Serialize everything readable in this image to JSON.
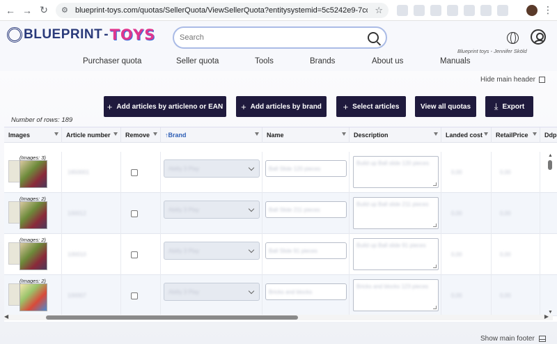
{
  "browser": {
    "url": "blueprint-toys.com/quotas/SellerQuota/ViewSellerQuota?entitysystemid=5c5242e9-7cdb-4d49-8..."
  },
  "header": {
    "logo_left": "BLUEPRINT",
    "logo_dash": "-",
    "logo_right": "TOYS",
    "search_placeholder": "Search",
    "user_text": "Blueprint toys - Jennifer Sköld",
    "nav": [
      "Purchaser quota",
      "Seller quota",
      "Tools",
      "Brands",
      "About us",
      "Manuals"
    ]
  },
  "content": {
    "hide_header": "Hide main header",
    "show_footer": "Show main footer",
    "row_count": "Number of rows: 189",
    "actions": [
      {
        "label": "Add articles by articleno or EAN",
        "icon": "plus-icon"
      },
      {
        "label": "Add articles by brand",
        "icon": "plus-icon"
      },
      {
        "label": "Select articles",
        "icon": "plus-icon"
      },
      {
        "label": "View all quotas",
        "icon": ""
      },
      {
        "label": "Export",
        "icon": "download-icon"
      }
    ]
  },
  "table": {
    "columns": [
      "Images",
      "Article number",
      "Remove",
      "↑Brand",
      "Name",
      "Description",
      "Landed cost",
      "RetailPrice",
      "Ddp"
    ],
    "sorted_column": "Brand",
    "rows": [
      {
        "images": "(Images: 3)",
        "article": "1650001",
        "brand": "Abilty 3 Play",
        "name": "Ball Slide 120 pieces",
        "description": "Build up Ball slide 120 pieces",
        "landed": "0,00",
        "retail": "0,00"
      },
      {
        "images": "(Images: 2)",
        "article": "100012",
        "brand": "Abilty 3 Play",
        "name": "Ball Slide 211 pieces",
        "description": "Build up Ball slide 211 pieces",
        "landed": "0,00",
        "retail": "0,00"
      },
      {
        "images": "(Images: 2)",
        "article": "100010",
        "brand": "Abilty 3 Play",
        "name": "Ball Slide 91 pieces",
        "description": "Build up Ball slide 91 pieces",
        "landed": "0,00",
        "retail": "0,00"
      },
      {
        "images": "(Images: 2)",
        "article": "100007",
        "brand": "Abilty 3 Play",
        "name": "Bricks and blocks",
        "description": "Bricks and blocks 123 pieces",
        "landed": "0,00",
        "retail": "0,00"
      }
    ]
  },
  "colors": {
    "accent_button": "#1f1a3d",
    "sort_blue": "#2f5fb5",
    "logo_pink": "#e0368e",
    "logo_navy": "#2a3a7a"
  }
}
